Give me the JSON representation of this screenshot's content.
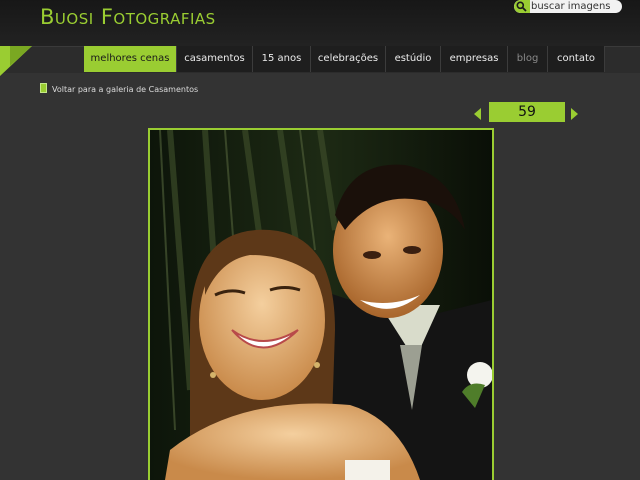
{
  "site": {
    "logo": "Buosi Fotografias"
  },
  "search": {
    "placeholder": "buscar imagens"
  },
  "nav": {
    "items": [
      {
        "label": "melhores cenas"
      },
      {
        "label": "casamentos"
      },
      {
        "label": "15 anos"
      },
      {
        "label": "celebrações"
      },
      {
        "label": "estúdio"
      },
      {
        "label": "empresas"
      },
      {
        "label": "blog"
      },
      {
        "label": "contato"
      }
    ],
    "active": "melhores cenas"
  },
  "gallery": {
    "back_label": "Voltar para a galeria de Casamentos",
    "current": "59"
  },
  "colors": {
    "accent": "#9acd32",
    "background": "#333333",
    "header": "#1b1b1b"
  },
  "icons": {
    "search": "search-icon",
    "prev": "arrow-left-icon",
    "next": "arrow-right-icon",
    "back": "back-icon"
  }
}
